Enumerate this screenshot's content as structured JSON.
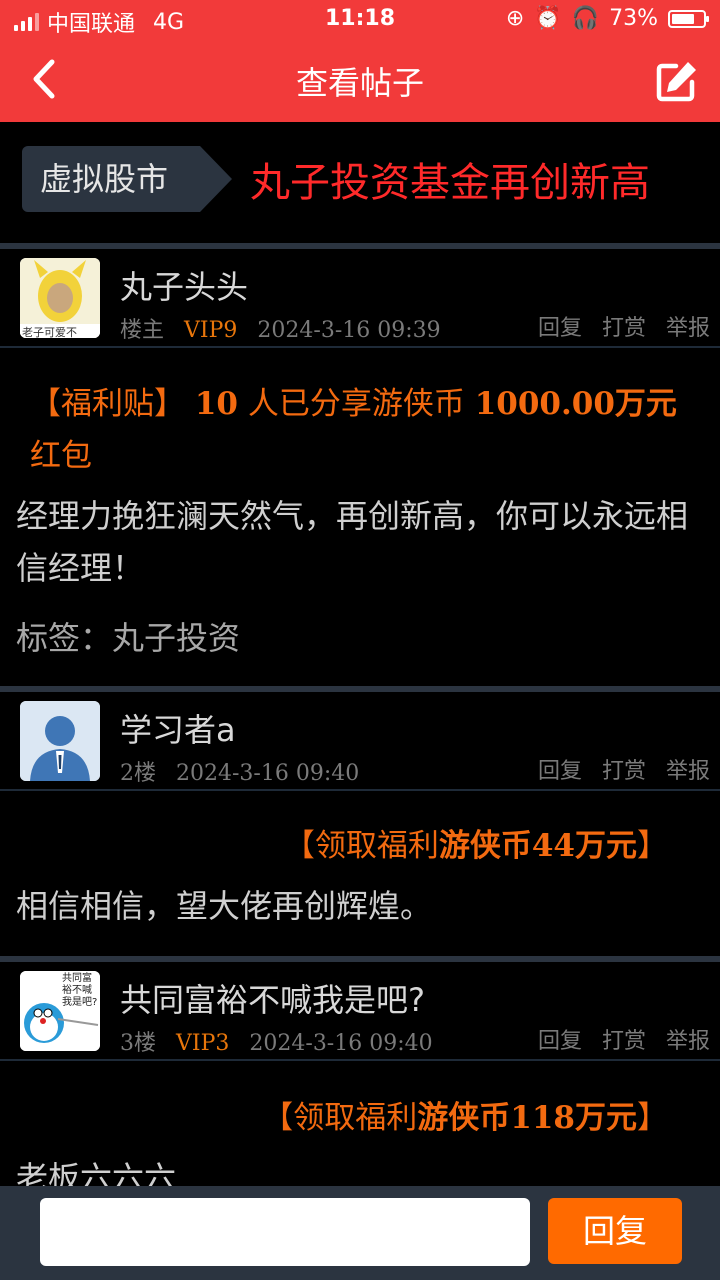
{
  "status": {
    "carrier": "中国联通",
    "network": "4G",
    "time": "11:18",
    "battery": "73%",
    "battery_level": 0.73
  },
  "nav": {
    "title": "查看帖子",
    "back_icon": "chevron-left-icon",
    "edit_icon": "edit-icon"
  },
  "banner": {
    "category": "虚拟股市",
    "headline": "丸子投资基金再创新高"
  },
  "posts": [
    {
      "user": "丸子头头",
      "floor": "楼主",
      "vip": "VIP9",
      "time": "2024-3-16 09:39",
      "avatar_text": "老子可爱不",
      "welfare_prefix": "【福利贴】",
      "welfare_count": "10",
      "welfare_mid": "人已分享游侠币",
      "welfare_amount": "1000.00万元",
      "welfare_suffix": "红包",
      "content": "经理力挽狂澜天然气，再创新高，你可以永远相信经理！",
      "tags": "标签：丸子投资"
    },
    {
      "user": "学习者a",
      "floor": "2楼",
      "vip": "",
      "time": "2024-3-16 09:40",
      "welfare_a": "【领取福利",
      "welfare_b": "游侠币44万元",
      "welfare_c": "】",
      "content": "相信相信，望大佬再创辉煌。"
    },
    {
      "user": "共同富裕不喊我是吧?",
      "floor": "3楼",
      "vip": "VIP3",
      "time": "2024-3-16 09:40",
      "avatar_text": "共同富裕不喊我是吧?",
      "welfare_a": "【领取福利",
      "welfare_b": "游侠币118万元",
      "welfare_c": "】",
      "content": "老板六六六"
    }
  ],
  "actions": {
    "reply": "回复",
    "tip": "打赏",
    "report": "举报"
  },
  "bottom": {
    "input_placeholder": "",
    "reply_button": "回复"
  }
}
